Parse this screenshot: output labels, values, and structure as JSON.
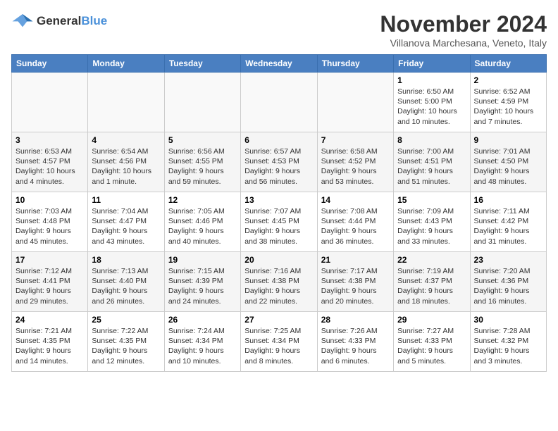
{
  "header": {
    "logo_line1": "General",
    "logo_line2": "Blue",
    "month_title": "November 2024",
    "location": "Villanova Marchesana, Veneto, Italy"
  },
  "days_of_week": [
    "Sunday",
    "Monday",
    "Tuesday",
    "Wednesday",
    "Thursday",
    "Friday",
    "Saturday"
  ],
  "weeks": [
    [
      {
        "day": "",
        "info": ""
      },
      {
        "day": "",
        "info": ""
      },
      {
        "day": "",
        "info": ""
      },
      {
        "day": "",
        "info": ""
      },
      {
        "day": "",
        "info": ""
      },
      {
        "day": "1",
        "info": "Sunrise: 6:50 AM\nSunset: 5:00 PM\nDaylight: 10 hours\nand 10 minutes."
      },
      {
        "day": "2",
        "info": "Sunrise: 6:52 AM\nSunset: 4:59 PM\nDaylight: 10 hours\nand 7 minutes."
      }
    ],
    [
      {
        "day": "3",
        "info": "Sunrise: 6:53 AM\nSunset: 4:57 PM\nDaylight: 10 hours\nand 4 minutes."
      },
      {
        "day": "4",
        "info": "Sunrise: 6:54 AM\nSunset: 4:56 PM\nDaylight: 10 hours\nand 1 minute."
      },
      {
        "day": "5",
        "info": "Sunrise: 6:56 AM\nSunset: 4:55 PM\nDaylight: 9 hours\nand 59 minutes."
      },
      {
        "day": "6",
        "info": "Sunrise: 6:57 AM\nSunset: 4:53 PM\nDaylight: 9 hours\nand 56 minutes."
      },
      {
        "day": "7",
        "info": "Sunrise: 6:58 AM\nSunset: 4:52 PM\nDaylight: 9 hours\nand 53 minutes."
      },
      {
        "day": "8",
        "info": "Sunrise: 7:00 AM\nSunset: 4:51 PM\nDaylight: 9 hours\nand 51 minutes."
      },
      {
        "day": "9",
        "info": "Sunrise: 7:01 AM\nSunset: 4:50 PM\nDaylight: 9 hours\nand 48 minutes."
      }
    ],
    [
      {
        "day": "10",
        "info": "Sunrise: 7:03 AM\nSunset: 4:48 PM\nDaylight: 9 hours\nand 45 minutes."
      },
      {
        "day": "11",
        "info": "Sunrise: 7:04 AM\nSunset: 4:47 PM\nDaylight: 9 hours\nand 43 minutes."
      },
      {
        "day": "12",
        "info": "Sunrise: 7:05 AM\nSunset: 4:46 PM\nDaylight: 9 hours\nand 40 minutes."
      },
      {
        "day": "13",
        "info": "Sunrise: 7:07 AM\nSunset: 4:45 PM\nDaylight: 9 hours\nand 38 minutes."
      },
      {
        "day": "14",
        "info": "Sunrise: 7:08 AM\nSunset: 4:44 PM\nDaylight: 9 hours\nand 36 minutes."
      },
      {
        "day": "15",
        "info": "Sunrise: 7:09 AM\nSunset: 4:43 PM\nDaylight: 9 hours\nand 33 minutes."
      },
      {
        "day": "16",
        "info": "Sunrise: 7:11 AM\nSunset: 4:42 PM\nDaylight: 9 hours\nand 31 minutes."
      }
    ],
    [
      {
        "day": "17",
        "info": "Sunrise: 7:12 AM\nSunset: 4:41 PM\nDaylight: 9 hours\nand 29 minutes."
      },
      {
        "day": "18",
        "info": "Sunrise: 7:13 AM\nSunset: 4:40 PM\nDaylight: 9 hours\nand 26 minutes."
      },
      {
        "day": "19",
        "info": "Sunrise: 7:15 AM\nSunset: 4:39 PM\nDaylight: 9 hours\nand 24 minutes."
      },
      {
        "day": "20",
        "info": "Sunrise: 7:16 AM\nSunset: 4:38 PM\nDaylight: 9 hours\nand 22 minutes."
      },
      {
        "day": "21",
        "info": "Sunrise: 7:17 AM\nSunset: 4:38 PM\nDaylight: 9 hours\nand 20 minutes."
      },
      {
        "day": "22",
        "info": "Sunrise: 7:19 AM\nSunset: 4:37 PM\nDaylight: 9 hours\nand 18 minutes."
      },
      {
        "day": "23",
        "info": "Sunrise: 7:20 AM\nSunset: 4:36 PM\nDaylight: 9 hours\nand 16 minutes."
      }
    ],
    [
      {
        "day": "24",
        "info": "Sunrise: 7:21 AM\nSunset: 4:35 PM\nDaylight: 9 hours\nand 14 minutes."
      },
      {
        "day": "25",
        "info": "Sunrise: 7:22 AM\nSunset: 4:35 PM\nDaylight: 9 hours\nand 12 minutes."
      },
      {
        "day": "26",
        "info": "Sunrise: 7:24 AM\nSunset: 4:34 PM\nDaylight: 9 hours\nand 10 minutes."
      },
      {
        "day": "27",
        "info": "Sunrise: 7:25 AM\nSunset: 4:34 PM\nDaylight: 9 hours\nand 8 minutes."
      },
      {
        "day": "28",
        "info": "Sunrise: 7:26 AM\nSunset: 4:33 PM\nDaylight: 9 hours\nand 6 minutes."
      },
      {
        "day": "29",
        "info": "Sunrise: 7:27 AM\nSunset: 4:33 PM\nDaylight: 9 hours\nand 5 minutes."
      },
      {
        "day": "30",
        "info": "Sunrise: 7:28 AM\nSunset: 4:32 PM\nDaylight: 9 hours\nand 3 minutes."
      }
    ]
  ]
}
